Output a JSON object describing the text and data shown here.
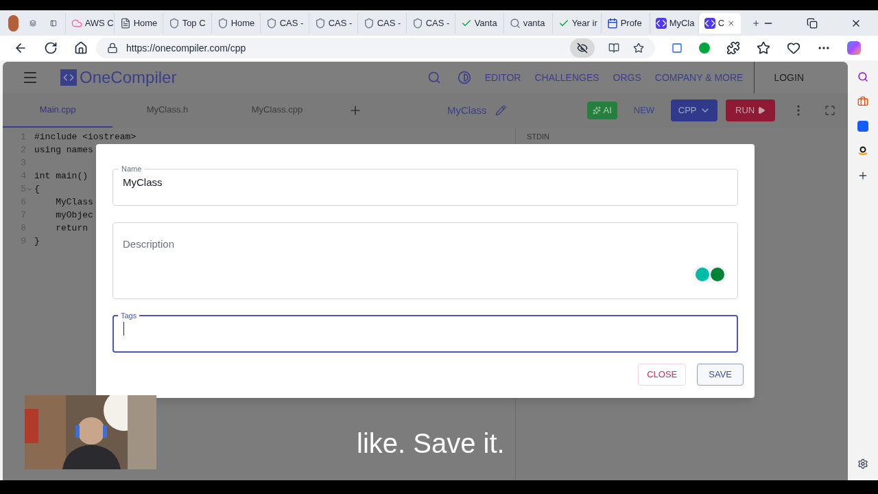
{
  "browser": {
    "tabs": [
      {
        "title": "AWS C",
        "kind": "cloud",
        "selected": false
      },
      {
        "title": "Home",
        "kind": "doc",
        "selected": false
      },
      {
        "title": "Top C",
        "kind": "shield",
        "selected": false
      },
      {
        "title": "Home",
        "kind": "shield",
        "selected": false
      },
      {
        "title": "CAS -",
        "kind": "shield",
        "selected": false
      },
      {
        "title": "CAS -",
        "kind": "shield",
        "selected": false
      },
      {
        "title": "CAS -",
        "kind": "shield",
        "selected": false
      },
      {
        "title": "CAS -",
        "kind": "shield",
        "selected": false
      },
      {
        "title": "Vanta",
        "kind": "check",
        "selected": false
      },
      {
        "title": "vanta",
        "kind": "search",
        "selected": false
      },
      {
        "title": "Year ir",
        "kind": "check",
        "selected": false
      },
      {
        "title": "Profe",
        "kind": "calendar",
        "selected": false
      },
      {
        "title": "MyCla",
        "kind": "code",
        "selected": false
      },
      {
        "title": "C",
        "kind": "code",
        "selected": true
      }
    ],
    "url": "https://onecompiler.com/cpp"
  },
  "site": {
    "logo": "OneCompiler",
    "nav": [
      "EDITOR",
      "CHALLENGES",
      "ORGS",
      "COMPANY & MORE"
    ],
    "login": "LOGIN"
  },
  "file_tabs": [
    {
      "label": "Main.cpp",
      "selected": true
    },
    {
      "label": "MyClass.h",
      "selected": false
    },
    {
      "label": "MyClass.cpp",
      "selected": false
    }
  ],
  "project_name": "MyClass",
  "toolbar": {
    "ai": "AI",
    "new": "NEW",
    "language": "CPP",
    "run": "RUN"
  },
  "editor": {
    "lines": [
      {
        "number": "1",
        "text": "#include <iostream>",
        "foldable": false
      },
      {
        "number": "2",
        "text": "using names",
        "foldable": false
      },
      {
        "number": "3",
        "foldable": false
      },
      {
        "number": "4",
        "text": "int main()",
        "foldable": false
      },
      {
        "number": "5",
        "text": "{",
        "foldable": true
      },
      {
        "number": "6",
        "text": "    MyClass",
        "foldable": false
      },
      {
        "number": "7",
        "text": "    myObjec",
        "foldable": false
      },
      {
        "number": "8",
        "text": "    return",
        "foldable": false
      },
      {
        "number": "9",
        "text": "}",
        "foldable": false
      }
    ]
  },
  "stdin_label": "STDIN",
  "dialog": {
    "name": {
      "label": "Name",
      "value": "MyClass"
    },
    "description": {
      "placeholder": "Description"
    },
    "tags": {
      "label": "Tags",
      "focused": true
    },
    "close": "CLOSE",
    "save": "SAVE"
  },
  "caption": "like. Save it."
}
